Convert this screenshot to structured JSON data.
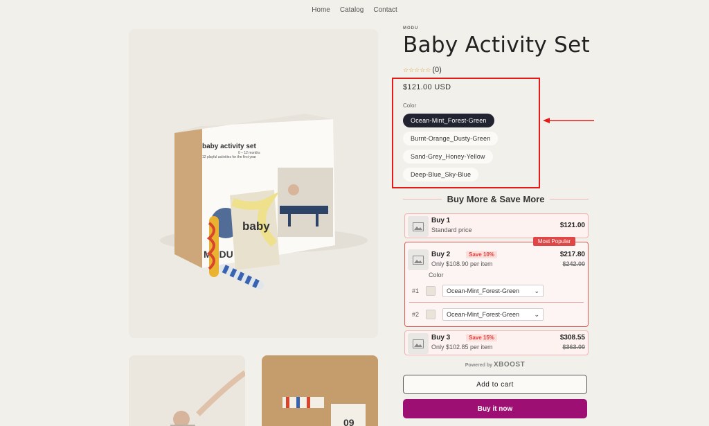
{
  "nav": {
    "items": [
      "Home",
      "Catalog",
      "Contact"
    ]
  },
  "product": {
    "brand": "MODU",
    "title": "Baby Activity Set",
    "stars": "☆☆☆☆☆",
    "reviews": "(0)",
    "price": "$121.00 USD",
    "color_label": "Color",
    "colors": [
      "Ocean-Mint_Forest-Green",
      "Burnt-Orange_Dusty-Green",
      "Sand-Grey_Honey-Yellow",
      "Deep-Blue_Sky-Blue"
    ],
    "selected_color": "Ocean-Mint_Forest-Green",
    "box_text": {
      "brand": "MODU",
      "title": "baby activity set",
      "sub": "12 playful activities for the first year",
      "range": "0 – 12 months",
      "book": "baby"
    }
  },
  "bundle": {
    "title": "Buy More & Save More",
    "offers": [
      {
        "title": "Buy 1",
        "sub": "Standard price",
        "price": "$121.00"
      },
      {
        "title": "Buy 2",
        "save": "Save 10%",
        "sub": "Only $108.90 per item",
        "price": "$217.80",
        "old": "$242.00",
        "badge": "Most Popular",
        "color_label": "Color",
        "selects": [
          {
            "num": "#1",
            "value": "Ocean-Mint_Forest-Green"
          },
          {
            "num": "#2",
            "value": "Ocean-Mint_Forest-Green"
          }
        ]
      },
      {
        "title": "Buy 3",
        "save": "Save 15%",
        "sub": "Only $102.85 per item",
        "price": "$308.55",
        "old": "$363.00"
      }
    ],
    "powered_prefix": "Powered by",
    "powered_brand": "XBOOST"
  },
  "buttons": {
    "add_to_cart": "Add to cart",
    "buy_now": "Buy it now"
  },
  "colors": {
    "accent": "#9e0f73",
    "highlight": "#e41b17",
    "dark_swatch": "#222330",
    "sale": "#e23c3c"
  }
}
